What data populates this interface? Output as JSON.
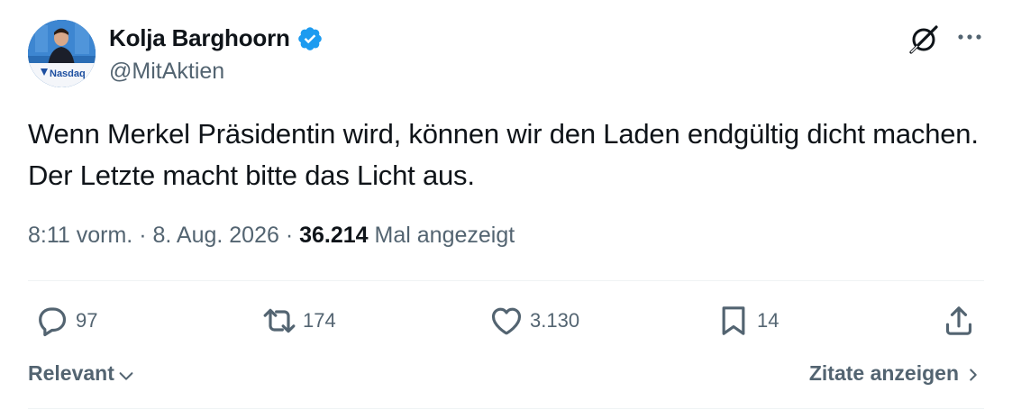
{
  "author": {
    "display_name": "Kolja Barghoorn",
    "handle": "@MitAktien",
    "verified": true,
    "avatar_banner_text": "Nasdaq"
  },
  "icons": {
    "verified": "verified-badge-icon",
    "grok": "grok-icon",
    "more": "more-options-icon",
    "reply": "reply-icon",
    "retweet": "retweet-icon",
    "like": "like-icon",
    "bookmark": "bookmark-icon",
    "share": "share-icon",
    "chevron_down": "chevron-down-icon",
    "chevron_right": "chevron-right-icon"
  },
  "tweet": {
    "text": "Wenn Merkel Präsidentin wird, können wir den Laden endgültig dicht machen. Der Letzte macht bitte das Licht aus.",
    "time": "8:11 vorm.",
    "separator": "·",
    "date": "8. Aug. 2026",
    "views_count": "36.214",
    "views_label": "Mal angezeigt"
  },
  "actions": {
    "replies": "97",
    "retweets": "174",
    "likes": "3.130",
    "bookmarks": "14"
  },
  "footer": {
    "sort_label": "Relevant",
    "quotes_label": "Zitate anzeigen"
  },
  "colors": {
    "text_primary": "#0f1419",
    "text_secondary": "#536471",
    "verified_blue": "#1d9bf0",
    "divider": "#eff3f4"
  }
}
